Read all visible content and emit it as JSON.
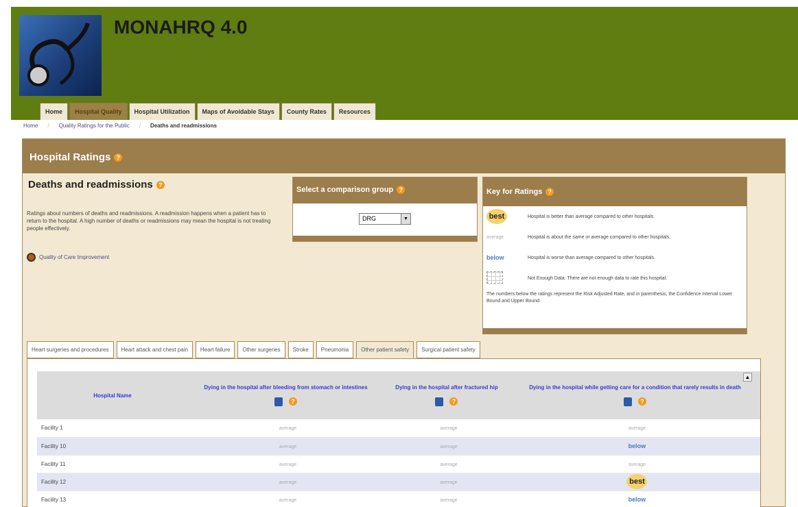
{
  "app": {
    "title": "MONAHRQ 4.0"
  },
  "nav": [
    {
      "label": "Home",
      "active": false
    },
    {
      "label": "Hospital Quality",
      "active": true
    },
    {
      "label": "Hospital Utilization",
      "active": false
    },
    {
      "label": "Maps of Avoidable Stays",
      "active": false
    },
    {
      "label": "County Rates",
      "active": false
    },
    {
      "label": "Resources",
      "active": false
    }
  ],
  "breadcrumb": [
    "Home",
    "Quality Ratings for the Public",
    "Deaths and readmissions"
  ],
  "panel": {
    "title": "Hospital Ratings",
    "section_title": "Deaths and readmissions",
    "intro": "Ratings about numbers of deaths and readmissions. A readmission happens when a patient has to return to the hospital. A high number of deaths or readmissions may mean the hospital is not treating people effectively.",
    "improve_link": "Quality of Care Improvement"
  },
  "comparison": {
    "title": "Select a comparison group",
    "selected": "DRG"
  },
  "key": {
    "title": "Key for Ratings",
    "rows": [
      {
        "badge": "best",
        "text": "Hospital is better than average compared to other hospitals."
      },
      {
        "badge": "average",
        "text": "Hospital is about the same or average compared to other hospitals."
      },
      {
        "badge": "below",
        "text": "Hospital is worse than average compared to other hospitals."
      },
      {
        "badge": "grid",
        "text": "Not Enough Data: There are not enough data to rate this hospital."
      }
    ],
    "note": "The numbers below the ratings represent the Risk Adjusted Rate, and in parenthesis, the Confidence Interval Lower Bound and Upper Bound."
  },
  "tabs": [
    "Heart surgeries and procedures",
    "Heart attack and chest pain",
    "Heart failure",
    "Other surgeries",
    "Stroke",
    "Pneumonia",
    "Other patient safety",
    "Surgical patient safety"
  ],
  "active_tab_index": 6,
  "table": {
    "columns": [
      "Hospital Name",
      "Dying in the hospital after bleeding from stomach or intestines",
      "Dying in the hospital after fractured hip",
      "Dying in the hospital while getting care for a condition that rarely results in death"
    ],
    "rows": [
      {
        "name": "Facility 1",
        "ratings": [
          "average",
          "average",
          "average"
        ]
      },
      {
        "name": "Facility 10",
        "ratings": [
          "average",
          "average",
          "below"
        ]
      },
      {
        "name": "Facility 11",
        "ratings": [
          "average",
          "average",
          "average"
        ]
      },
      {
        "name": "Facility 12",
        "ratings": [
          "average",
          "average",
          "best"
        ]
      },
      {
        "name": "Facility 13",
        "ratings": [
          "average",
          "average",
          "below"
        ]
      }
    ]
  },
  "colors": {
    "header_green": "#5f7d10",
    "panel_brown": "#9c7d4c",
    "panel_beige": "#f3e9d2",
    "help_orange": "#f39a1e"
  }
}
